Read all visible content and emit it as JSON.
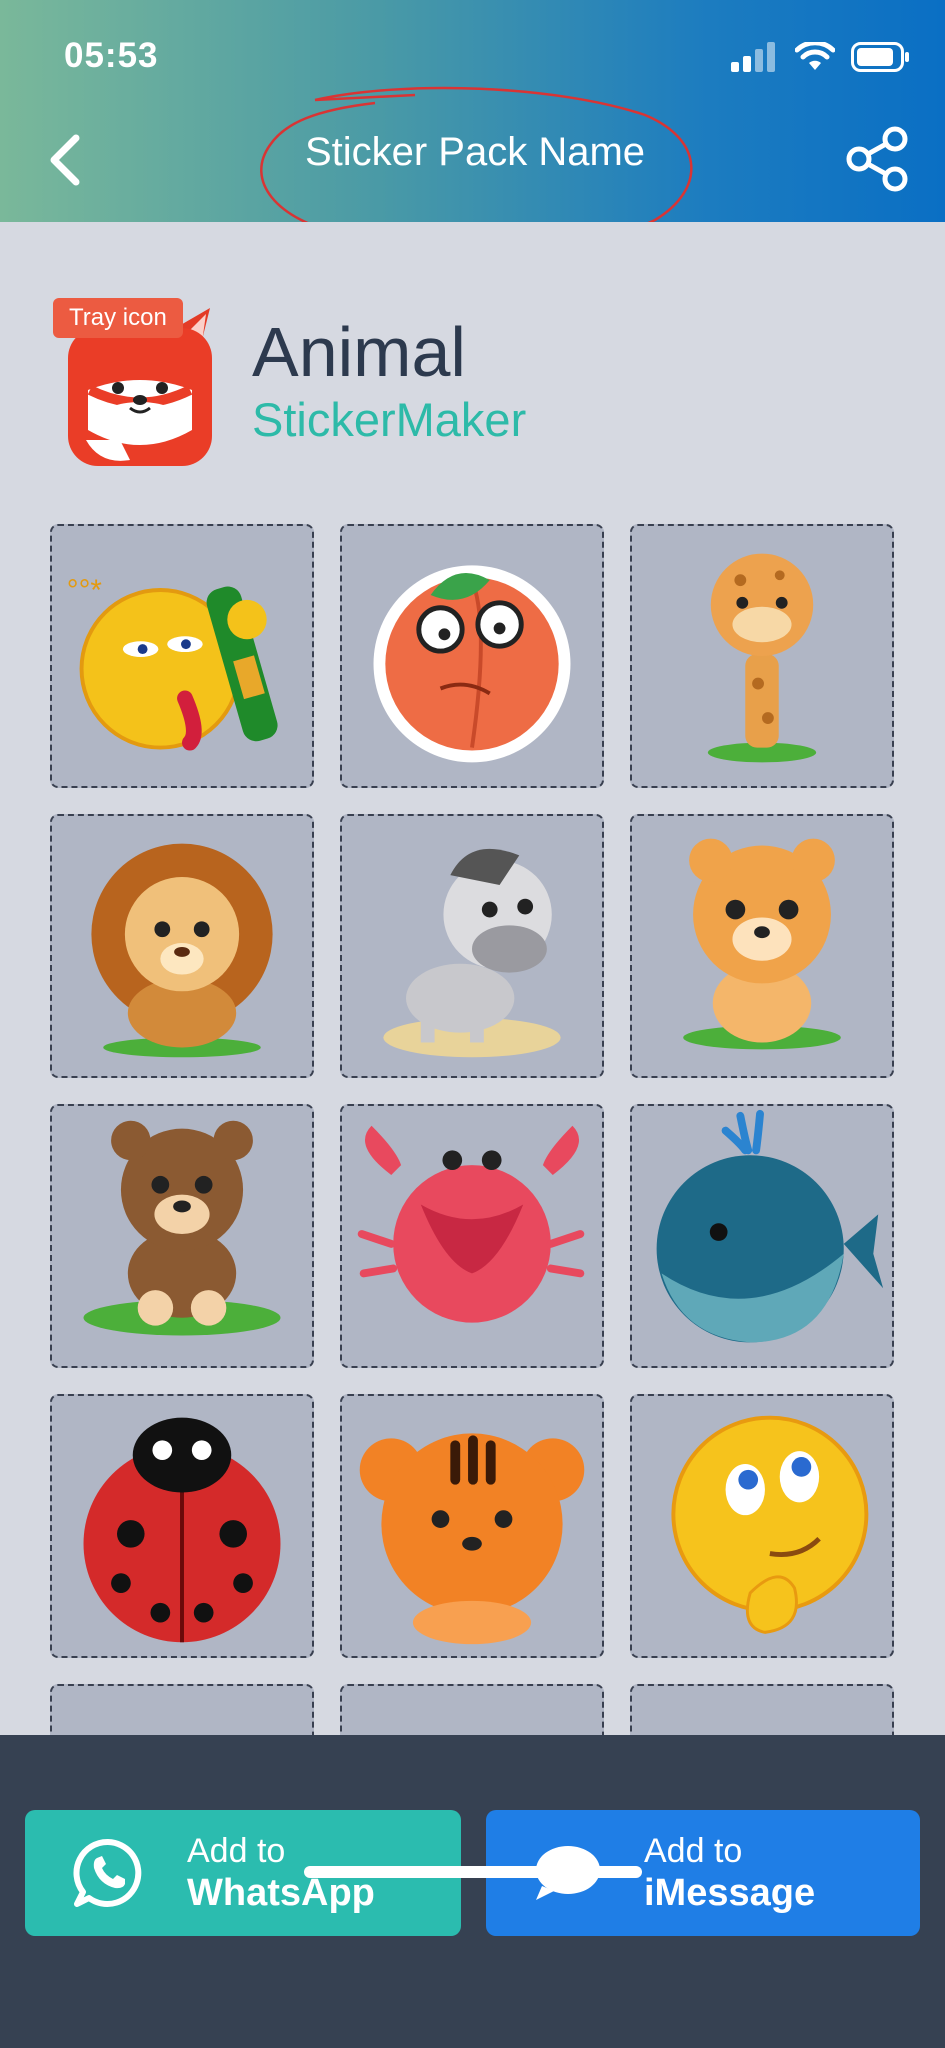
{
  "status_bar": {
    "time": "05:53"
  },
  "nav": {
    "title": "Sticker Pack Name"
  },
  "pack": {
    "tray_label": "Tray icon",
    "name": "Animal",
    "author": "StickerMaker"
  },
  "stickers": [
    {
      "name": "drunk-emoji-sticker"
    },
    {
      "name": "peach-sticker"
    },
    {
      "name": "giraffe-sticker"
    },
    {
      "name": "lion-sticker"
    },
    {
      "name": "zebra-sticker"
    },
    {
      "name": "tiger-cub-sticker"
    },
    {
      "name": "bear-sticker"
    },
    {
      "name": "crab-sticker"
    },
    {
      "name": "whale-sticker"
    },
    {
      "name": "ladybug-sticker"
    },
    {
      "name": "tiger-face-sticker"
    },
    {
      "name": "thinking-emoji-sticker"
    }
  ],
  "actions": {
    "whatsapp": {
      "line1": "Add to",
      "line2": "WhatsApp",
      "icon": "whatsapp-icon"
    },
    "imessage": {
      "line1": "Add to",
      "line2": "iMessage",
      "icon": "message-bubble-icon"
    }
  },
  "colors": {
    "whatsapp": "#2bbcaf",
    "imessage": "#1f7ee6",
    "footer": "#364152",
    "author": "#2dbaa8"
  }
}
